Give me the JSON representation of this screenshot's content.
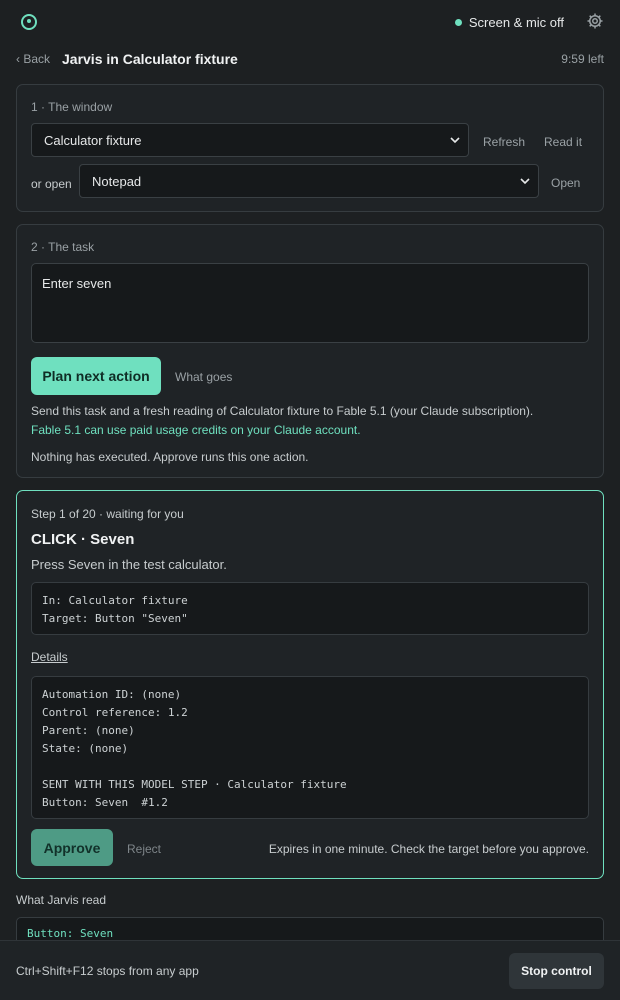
{
  "topbar": {
    "status_text": "Screen & mic off",
    "status_color": "#6fe0bf",
    "logo_icon": "ring-logo-icon",
    "settings_icon": "gear-icon"
  },
  "header": {
    "back_label": "‹ Back",
    "title": "Jarvis in Calculator fixture",
    "time_left": "9:59 left"
  },
  "window_section": {
    "label": "1 · The window",
    "selected_window": "Calculator fixture",
    "refresh_label": "Refresh",
    "read_label": "Read it",
    "or_open_label": "or open",
    "open_app": "Notepad",
    "open_label": "Open"
  },
  "task_section": {
    "label": "2 · The task",
    "task_text": "Enter seven",
    "plan_label": "Plan next action",
    "what_goes_label": "What goes",
    "info_line": "Send this task and a fresh reading of Calculator fixture to Fable 5.1 (your Claude subscription).",
    "credits_line": "Fable 5.1 can use paid usage credits on your Claude account.",
    "nothing_line": "Nothing has executed. Approve runs this one action."
  },
  "step": {
    "status": "Step 1 of 20 · waiting for you",
    "action": "CLICK · Seven",
    "description": "Press Seven in the test calculator.",
    "in_line": "In: Calculator fixture",
    "target_line": "Target: Button \"Seven\"",
    "details_label": "Details",
    "detail_lines": [
      "Automation ID: (none)",
      "Control reference: 1.2",
      "Parent: (none)",
      "State: (none)",
      "",
      "SENT WITH THIS MODEL STEP · Calculator fixture",
      "Button: Seven  #1.2"
    ],
    "approve_label": "Approve",
    "reject_label": "Reject",
    "expires_text": "Expires in one minute. Check the target before you approve."
  },
  "read": {
    "label": "What Jarvis read",
    "content": "Button: Seven"
  },
  "footer": {
    "hint": "Ctrl+Shift+F12 stops from any app",
    "stop_label": "Stop control"
  }
}
